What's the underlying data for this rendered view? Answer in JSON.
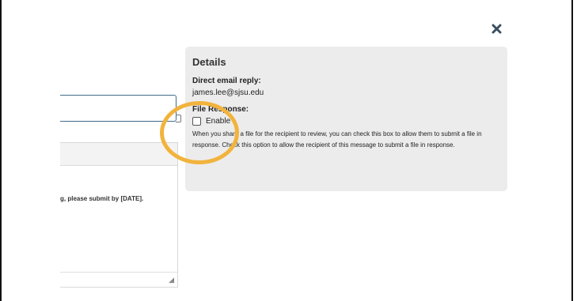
{
  "background_form": {
    "editor_body_text": "g, please submit by [DATE]."
  },
  "modal": {
    "close_icon": "close-icon",
    "details": {
      "heading": "Details",
      "direct_email_label": "Direct email reply:",
      "direct_email_value": "james.lee@sjsu.edu",
      "file_response_label": "File Response:",
      "enable_label": "Enable",
      "enable_checked": false,
      "help_text": "When you share a file for the recipient to review, you can check this box to allow them to submit a file in response. Check this option to allow the recipient of this message to submit a file in response."
    }
  },
  "colors": {
    "panel_bg": "#ececec",
    "highlight": "#f2b33d",
    "input_border": "#3f6d8c"
  }
}
